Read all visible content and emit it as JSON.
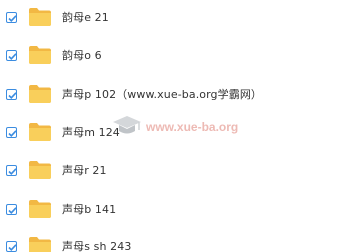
{
  "files": [
    {
      "name": "韵母e 21",
      "checked": true
    },
    {
      "name": "韵母o 6",
      "checked": true
    },
    {
      "name": "声母p 102（www.xue-ba.org学霸网）",
      "checked": true
    },
    {
      "name": "声母m 124",
      "checked": true
    },
    {
      "name": "声母r 21",
      "checked": true
    },
    {
      "name": "声母b 141",
      "checked": true
    },
    {
      "name": "声母s sh 243",
      "checked": true
    }
  ],
  "watermark": {
    "text": "www.xue-ba.org"
  },
  "colors": {
    "checkbox": "#3b8ce0",
    "folder": "#f9cf5b",
    "folder_dark": "#f2b844",
    "watermark": "#e8a39c"
  },
  "icons": {
    "folder": "folder-icon",
    "check": "check-icon",
    "watermark": "graduation-cap-icon"
  }
}
